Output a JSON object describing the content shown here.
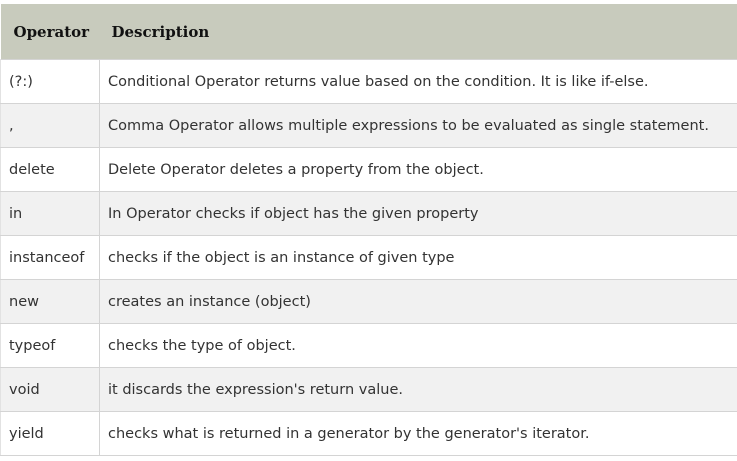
{
  "table": {
    "headers": {
      "operator": "Operator",
      "description": "Description"
    },
    "rows": [
      {
        "operator": "(?:)",
        "description": "Conditional Operator returns value based on the condition. It is like if-else."
      },
      {
        "operator": ",",
        "description": "Comma Operator allows multiple expressions to be evaluated as single statement."
      },
      {
        "operator": "delete",
        "description": "Delete Operator deletes a property from the object."
      },
      {
        "operator": "in",
        "description": "In Operator checks if object has the given property"
      },
      {
        "operator": "instanceof",
        "description": "checks if the object is an instance of given type"
      },
      {
        "operator": "new",
        "description": "creates an instance (object)"
      },
      {
        "operator": "typeof",
        "description": "checks the type of object."
      },
      {
        "operator": "void",
        "description": "it discards the expression's return value."
      },
      {
        "operator": "yield",
        "description": "checks what is returned in a generator by the generator's iterator."
      }
    ]
  },
  "colors": {
    "header_bg": "#c8cbbd",
    "row_alt_bg": "#f1f1f1",
    "border": "#d4d4d4"
  }
}
